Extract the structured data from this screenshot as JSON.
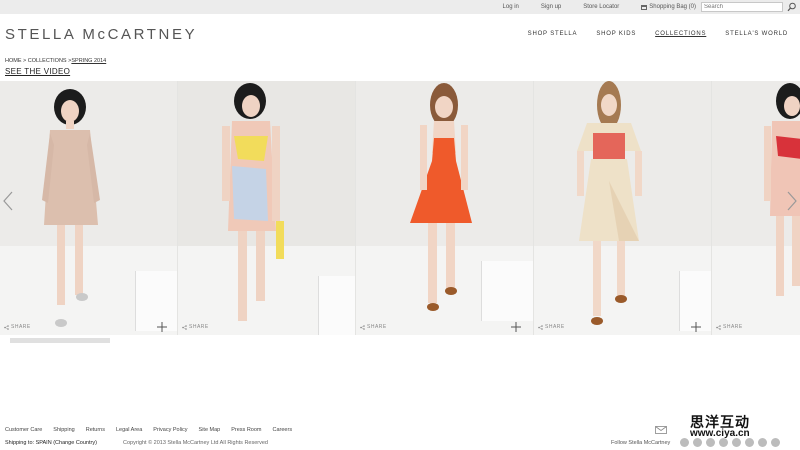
{
  "topbar": {
    "login": "Log in",
    "signup": "Sign up",
    "store_locator": "Store Locator",
    "shopping_bag": "Shopping Bag (0)",
    "search_placeholder": "Search"
  },
  "header": {
    "logo": "STELLA McCARTNEY",
    "nav": [
      {
        "label": "SHOP STELLA",
        "active": false
      },
      {
        "label": "SHOP KIDS",
        "active": false
      },
      {
        "label": "COLLECTIONS",
        "active": true
      },
      {
        "label": "STELLA'S WORLD",
        "active": false
      }
    ]
  },
  "breadcrumb": {
    "home": "HOME",
    "sep1": " > ",
    "collections": "COLLECTIONS",
    "sep2": " >",
    "current": "SPRING 2014"
  },
  "see_video": "SEE THE VIDEO",
  "gallery": {
    "share_label": "SHARE",
    "looks": [
      {
        "dress": "pale pink lace coat",
        "accent": "#d9b9a8",
        "accent2": "#e4cdbf"
      },
      {
        "dress": "pink shift with yellow and blue lace",
        "accent": "#f0c9b8",
        "accent2": "#f2dc5b"
      },
      {
        "dress": "orange bow-front dress",
        "accent": "#ef5a2b",
        "accent2": "#e04a1e"
      },
      {
        "dress": "cream dress with red print bib",
        "accent": "#eee1c8",
        "accent2": "#e4665a"
      },
      {
        "dress": "pink shift with red lips",
        "accent": "#f0c5b6",
        "accent2": "#d8323a"
      }
    ]
  },
  "footer": {
    "links": [
      "Customer Care",
      "Shipping",
      "Returns",
      "Legal Area",
      "Privacy Policy",
      "Site Map",
      "Press Room",
      "Careers"
    ],
    "shipping_to": "Shipping to: SPAIN    (Change Country)",
    "copyright": "Copyright © 2013 Stella McCartney Ltd All Rights Reserved",
    "follow": "Follow Stella McCartney",
    "watermark_cn": "思洋互动",
    "watermark_url": "www.ciya.cn"
  }
}
